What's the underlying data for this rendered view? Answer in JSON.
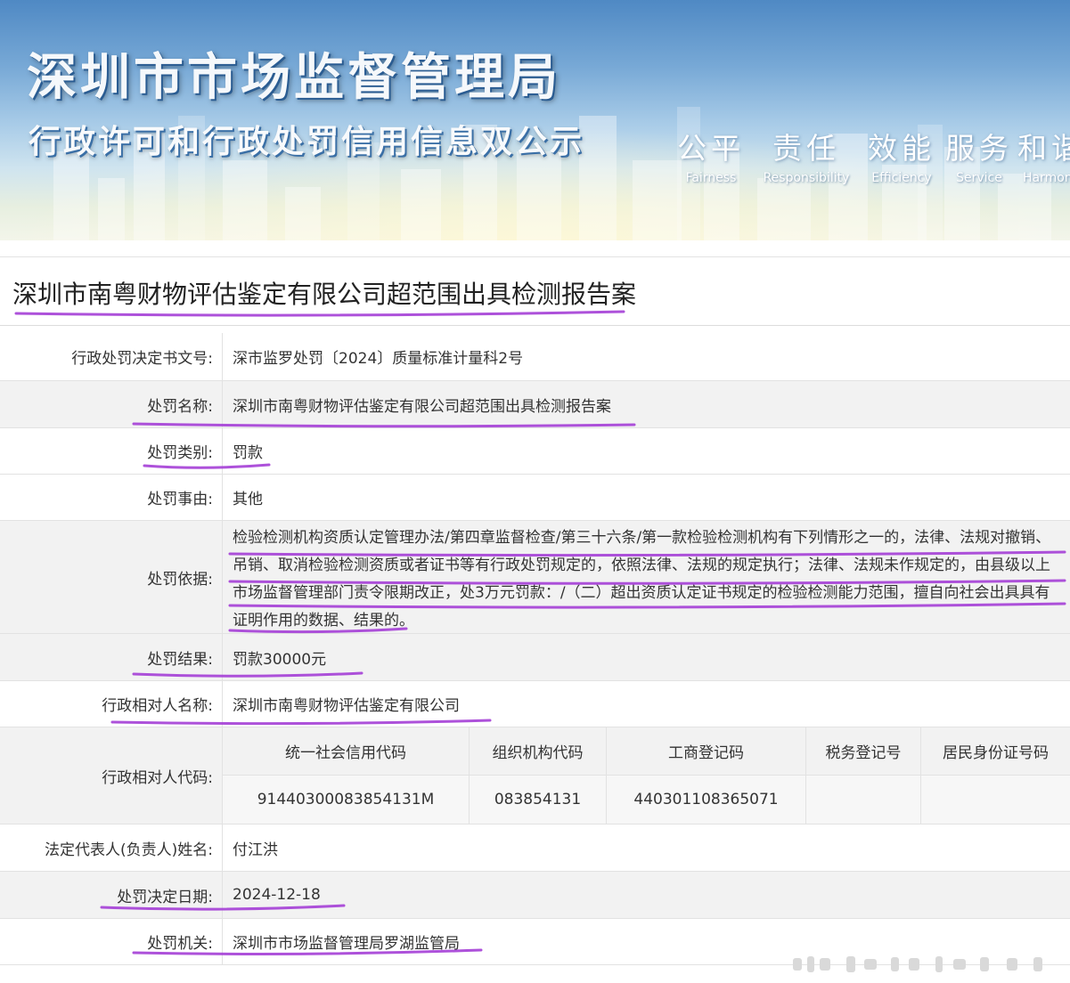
{
  "banner": {
    "title": "深圳市市场监督管理局",
    "subtitle": "行政许可和行政处罚信用信息双公示",
    "mottos": [
      {
        "zh": "公平",
        "en": "Fairness"
      },
      {
        "zh": "责任",
        "en": "Responsibility"
      },
      {
        "zh": "效能",
        "en": "Efficiency"
      },
      {
        "zh": "服务",
        "en": "Service"
      },
      {
        "zh": "和谐",
        "en": "Harmony"
      }
    ]
  },
  "case_title": "深圳市南粤财物评估鉴定有限公司超范围出具检测报告案",
  "fields": {
    "decision_no": {
      "label": "行政处罚决定书文号:",
      "value": "深市监罗处罚〔2024〕质量标准计量科2号"
    },
    "penalty_name": {
      "label": "处罚名称:",
      "value": "深圳市南粤财物评估鉴定有限公司超范围出具检测报告案"
    },
    "penalty_type": {
      "label": "处罚类别:",
      "value": "罚款"
    },
    "penalty_reason": {
      "label": "处罚事由:",
      "value": "其他"
    },
    "penalty_basis": {
      "label": "处罚依据:",
      "lines": [
        "检验检测机构资质认定管理办法/第四章监督检查/第三十六条/第一款检验检测机构有下列情形之一的，法律、法规对撤销、",
        "吊销、取消检验检测资质或者证书等有行政处罚规定的，依照法律、法规的规定执行；法律、法规未作规定的，由县级以上",
        "市场监督管理部门责令限期改正，处3万元罚款：/（二）超出资质认定证书规定的检验检测能力范围，擅自向社会出具具有",
        "证明作用的数据、结果的。"
      ]
    },
    "penalty_result": {
      "label": "处罚结果:",
      "value": "罚款30000元"
    },
    "party_name": {
      "label": "行政相对人名称:",
      "value": "深圳市南粤财物评估鉴定有限公司"
    },
    "party_codes": {
      "label": "行政相对人代码:",
      "headers": [
        "统一社会信用代码",
        "组织机构代码",
        "工商登记码",
        "税务登记号",
        "居民身份证号码"
      ],
      "values": [
        "91440300083854131M",
        "083854131",
        "440301108365071",
        "",
        ""
      ]
    },
    "legal_rep": {
      "label": "法定代表人(负责人)姓名:",
      "value": "付江洪"
    },
    "decision_date": {
      "label": "处罚决定日期:",
      "value": "2024-12-18"
    },
    "authority": {
      "label": "处罚机关:",
      "value": "深圳市市场监督管理局罗湖监管局"
    }
  },
  "colors": {
    "annotation_ink": "#a43ed6",
    "row_shade": "#f2f2f2",
    "banner_sky": "#4f89c4"
  }
}
